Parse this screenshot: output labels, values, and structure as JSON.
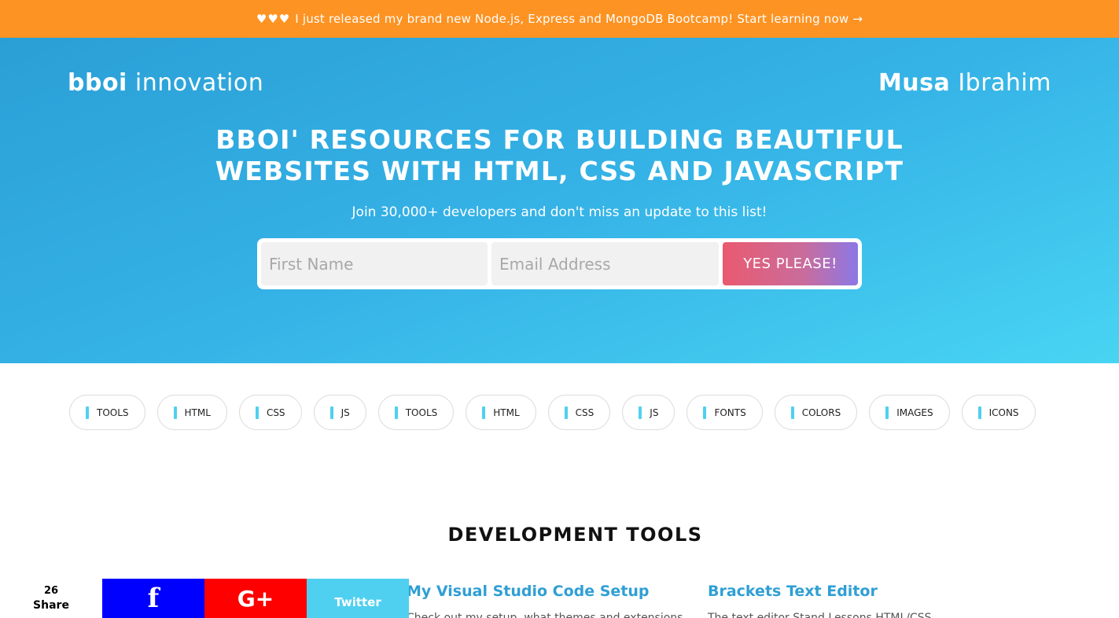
{
  "promo": {
    "hearts": "♥♥♥",
    "text": "I just released my brand new Node.js, Express and MongoDB Bootcamp! Start learning now →"
  },
  "brand": {
    "left_bold": "bboi",
    "left_light": "innovation",
    "right_bold": "Musa",
    "right_light": "Ibrahim"
  },
  "hero": {
    "title_line1": "BBOI' RESOURCES FOR BUILDING BEAUTIFUL",
    "title_line2": "WEBSITES WITH HTML, CSS AND JAVASCRIPT",
    "subtitle": "Join 30,000+ developers and don't miss an update to this list!",
    "first_name_placeholder": "First Name",
    "email_placeholder": "Email Address",
    "submit_label": "YES PLEASE!"
  },
  "tags": [
    "TOOLS",
    "HTML",
    "CSS",
    "JS",
    "TOOLS",
    "HTML",
    "CSS",
    "JS",
    "FONTS",
    "COLORS",
    "IMAGES",
    "ICONS"
  ],
  "section": {
    "title": "DEVELOPMENT TOOLS"
  },
  "cards": [
    {
      "title": "My Visual Studio Code Setup",
      "desc": "Check out my setup, what themes and extensions..."
    },
    {
      "title": "Brackets Text Editor",
      "desc": "The text editor Stand Lessons HTML/CSS..."
    }
  ],
  "share": {
    "count": "26",
    "label": "Share",
    "facebook": "f",
    "googleplus": "G+",
    "twitter": "Twitter"
  },
  "colors": {
    "promo_bg": "#fd9323",
    "hero_start": "#2a9fd6",
    "hero_end": "#48d4f3",
    "accent": "#4fd0f0",
    "card_title": "#2f9fd4"
  }
}
